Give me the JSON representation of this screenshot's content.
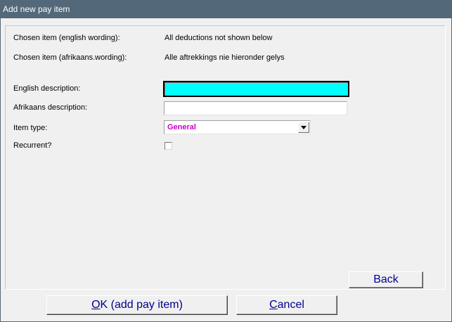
{
  "window": {
    "title": "Add new pay item"
  },
  "form": {
    "chosen_english_label": "Chosen item (english wording):",
    "chosen_english_value": "All deductions not shown below",
    "chosen_afrikaans_label": "Chosen item (afrikaans.wording):",
    "chosen_afrikaans_value": "Alle aftrekkings nie hieronder gelys",
    "english_desc_label": "English description:",
    "english_desc_value": "",
    "afrikaans_desc_label": "Afrikaans description:",
    "afrikaans_desc_value": "",
    "item_type_label": "Item type:",
    "item_type_value": "General",
    "recurrent_label": "Recurrent?",
    "recurrent_checked": false
  },
  "buttons": {
    "back": "Back",
    "ok_accel": "O",
    "ok_rest": "K (add pay item)",
    "cancel_accel": "C",
    "cancel_rest": "ancel"
  },
  "colors": {
    "titlebar": "#536878",
    "active_field": "#00ffff",
    "item_type_text": "#cc00cc",
    "button_text": "#00008b"
  }
}
